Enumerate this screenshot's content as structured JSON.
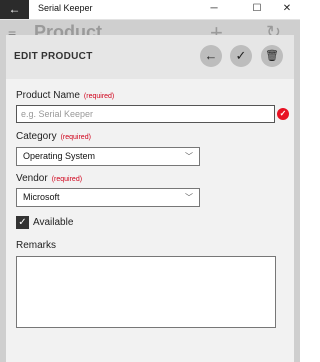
{
  "titlebar": {
    "back_icon": "←",
    "title": "Serial Keeper",
    "minimize": "─",
    "maximize": "☐",
    "close": "✕"
  },
  "background": {
    "menu_icon": "≡",
    "title": "Product",
    "add_icon": "+",
    "refresh_icon": "↻"
  },
  "dialog": {
    "title": "EDIT PRODUCT",
    "back_icon": "←",
    "save_icon": "✓",
    "delete_icon": "🗑",
    "product_name": {
      "label": "Product Name",
      "required": "(required)",
      "placeholder": "e.g. Serial Keeper",
      "error_icon": "✓"
    },
    "category": {
      "label": "Category",
      "required": "(required)",
      "value": "Operating System"
    },
    "vendor": {
      "label": "Vendor",
      "required": "(required)",
      "value": "Microsoft"
    },
    "available": {
      "label": "Available",
      "checked": true,
      "check_glyph": "✓"
    },
    "remarks": {
      "label": "Remarks",
      "value": ""
    },
    "dropdown_glyph": "﹀"
  }
}
